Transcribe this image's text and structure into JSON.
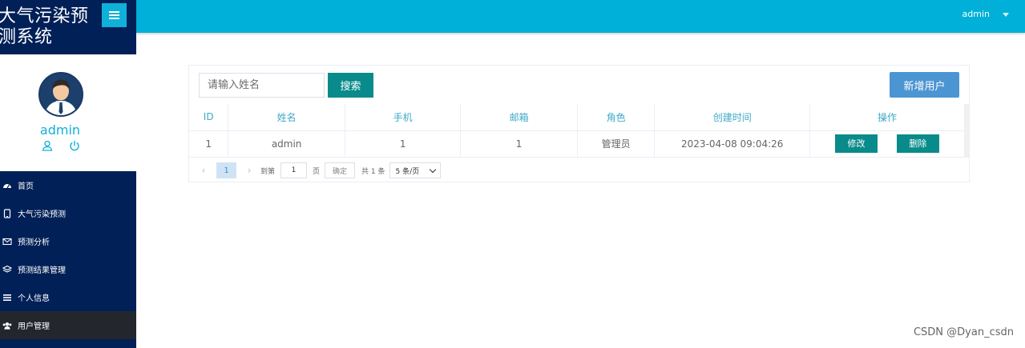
{
  "app": {
    "title": "大气污染预测系统"
  },
  "topbar": {
    "user": "admin"
  },
  "profile": {
    "name": "admin"
  },
  "nav": {
    "items": [
      {
        "label": "首页",
        "icon": "dashboard-icon"
      },
      {
        "label": "大气污染预测",
        "icon": "tablet-icon"
      },
      {
        "label": "预测分析",
        "icon": "envelope-icon"
      },
      {
        "label": "预测结果管理",
        "icon": "layers-icon"
      },
      {
        "label": "个人信息",
        "icon": "list-icon"
      },
      {
        "label": "用户管理",
        "icon": "users-icon",
        "active": true
      }
    ]
  },
  "search": {
    "placeholder": "请输入姓名",
    "button": "搜索"
  },
  "toolbar": {
    "add_button": "新增用户"
  },
  "table": {
    "headers": [
      "ID",
      "姓名",
      "手机",
      "邮箱",
      "角色",
      "创建时间",
      "操作"
    ],
    "rows": [
      {
        "id": "1",
        "name": "admin",
        "phone": "1",
        "email": "1",
        "role": "管理员",
        "created": "2023-04-08 09:04:26",
        "edit": "修改",
        "delete": "删除"
      }
    ]
  },
  "pagination": {
    "current_page": "1",
    "goto_prefix": "到第",
    "goto_value": "1",
    "goto_suffix": "页",
    "confirm": "确定",
    "total": "共 1 条",
    "page_size": "5 条/页"
  },
  "watermark": "CSDN @Dyan_csdn",
  "colors": {
    "sidebar": "#012057",
    "topbar": "#00b0d8",
    "primary_button": "#098b8b",
    "add_button": "#4c95d3",
    "accent": "#0fb0da"
  }
}
